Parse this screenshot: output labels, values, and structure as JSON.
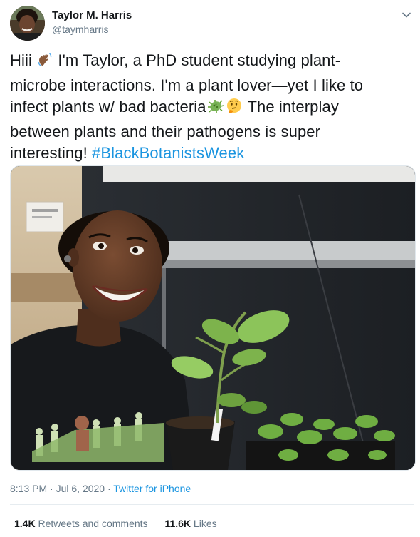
{
  "author": {
    "display_name": "Taylor M. Harris",
    "handle": "@taymharris"
  },
  "tweet": {
    "line1_text": "Hiii ",
    "line1_after_wave": " I'm Taylor, a PhD student studying plant-",
    "line2": "microbe interactions. I'm a plant lover—yet I like to",
    "line3_text": "infect plants w/ bad bacteria",
    "line3_after": " The interplay",
    "line4": "between plants and their pathogens is super",
    "line5_text": "interesting! ",
    "hashtag": "#BlackBotanistsWeek"
  },
  "meta": {
    "time": "8:13 PM · Jul 6, 2020 · ",
    "source": "Twitter for iPhone"
  },
  "stats": {
    "retweets_count": "1.4K",
    "retweets_label": "Retweets and comments",
    "likes_count": "11.6K",
    "likes_label": "Likes"
  },
  "colors": {
    "link": "#1b95e0",
    "secondary_text": "#657786",
    "primary_text": "#14171a"
  },
  "icons": [
    "chevron-down-icon",
    "waving-hand-icon",
    "microbe-icon",
    "thinking-face-icon"
  ]
}
